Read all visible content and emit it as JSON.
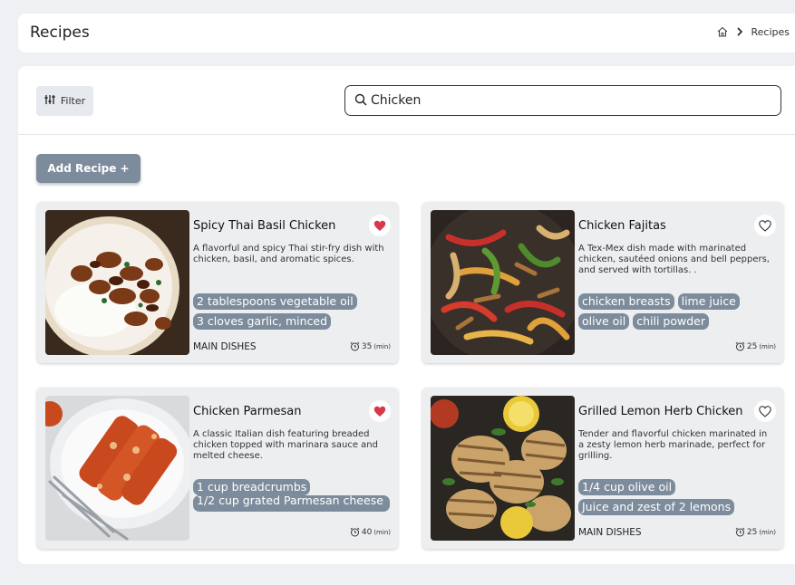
{
  "header": {
    "title": "Recipes",
    "breadcrumb": {
      "current": "Recipes"
    }
  },
  "toolbar": {
    "filter_label": "Filter",
    "search_value": "Chicken"
  },
  "add_recipe_label": "Add Recipe +",
  "recipes": [
    {
      "title": "Spicy Thai Basil Chicken",
      "favorite": true,
      "description": "A flavorful and spicy Thai stir-fry dish with chicken, basil, and aromatic spices.",
      "ingredients": [
        "2 tablespoons vegetable oil",
        "3 cloves garlic, minced"
      ],
      "category": "MAIN DISHES",
      "time": "35",
      "time_unit": "(min)"
    },
    {
      "title": "Chicken Fajitas",
      "favorite": false,
      "description": "A Tex-Mex dish made with marinated chicken, sautéed onions and bell peppers, and served with tortillas. .",
      "ingredients": [
        "chicken breasts",
        "lime juice",
        "olive oil",
        "chili powder"
      ],
      "category": "",
      "time": "25",
      "time_unit": "(min)"
    },
    {
      "title": "Chicken Parmesan",
      "favorite": true,
      "description": "A classic Italian dish featuring breaded chicken topped with marinara sauce and melted cheese.",
      "ingredients": [
        "1 cup breadcrumbs",
        "1/2 cup grated Parmesan cheese"
      ],
      "category": "",
      "time": "40",
      "time_unit": "(min)"
    },
    {
      "title": "Grilled Lemon Herb Chicken",
      "favorite": false,
      "description": "Tender and flavorful chicken marinated in a zesty lemon herb marinade, perfect for grilling.",
      "ingredients": [
        "1/4 cup olive oil",
        "Juice and zest of 2 lemons"
      ],
      "category": "MAIN DISHES",
      "time": "25",
      "time_unit": "(min)"
    }
  ],
  "colors": {
    "chip_bg": "#7d8c9c",
    "heart_filled": "#d8384a",
    "card_bg": "#eceef0"
  }
}
